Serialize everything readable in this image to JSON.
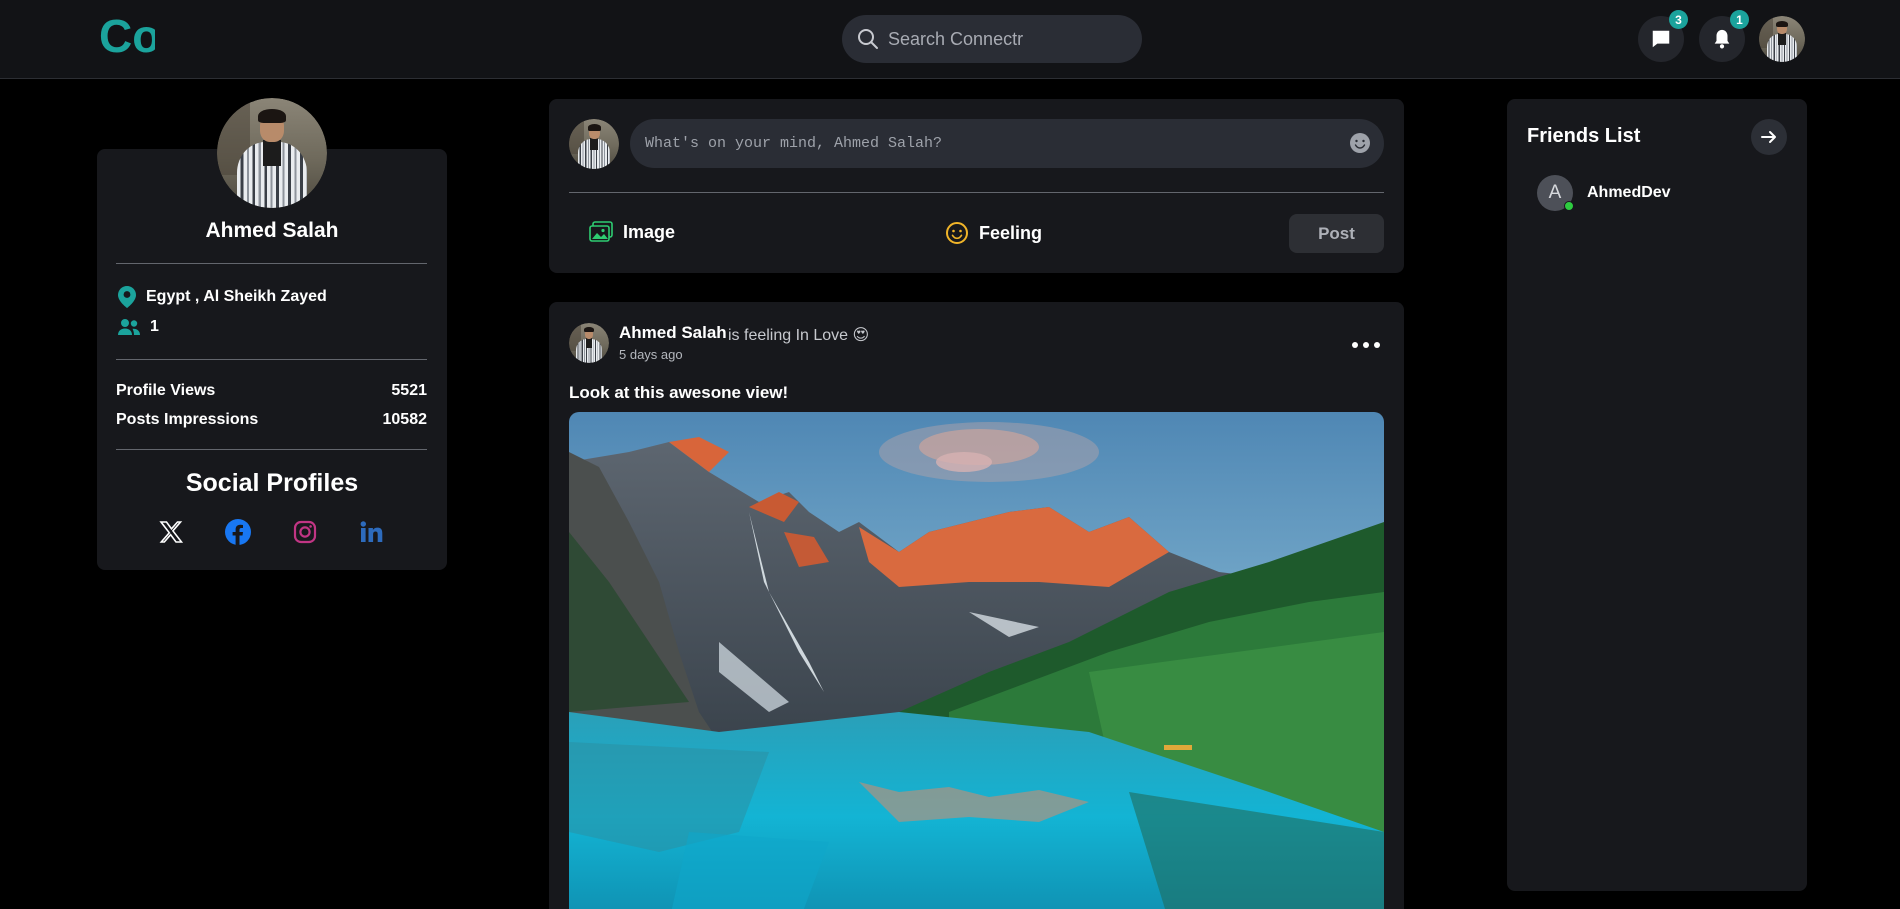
{
  "brand": {
    "logo_text": "Co",
    "accent": "#1ba39c"
  },
  "search": {
    "placeholder": "Search Connectr"
  },
  "header": {
    "messages_badge": "3",
    "notifications_badge": "1"
  },
  "profile": {
    "name": "Ahmed Salah",
    "location": "Egypt , Al Sheikh Zayed",
    "friends_count": "1",
    "stats": [
      {
        "label": "Profile Views",
        "value": "5521"
      },
      {
        "label": "Posts Impressions",
        "value": "10582"
      }
    ],
    "social_title": "Social Profiles",
    "social_links": [
      "x-icon",
      "facebook-icon",
      "instagram-icon",
      "linkedin-icon"
    ]
  },
  "composer": {
    "placeholder": "What's on your mind, Ahmed Salah?",
    "image_label": "Image",
    "feeling_label": "Feeling",
    "post_label": "Post"
  },
  "post": {
    "author": "Ahmed Salah",
    "feeling": "is feeling In Love 😍",
    "time": "5 days ago",
    "text": "Look at this awesone view!"
  },
  "friends": {
    "title": "Friends List",
    "items": [
      {
        "initial": "A",
        "name": "AhmedDev",
        "online": true
      }
    ]
  }
}
